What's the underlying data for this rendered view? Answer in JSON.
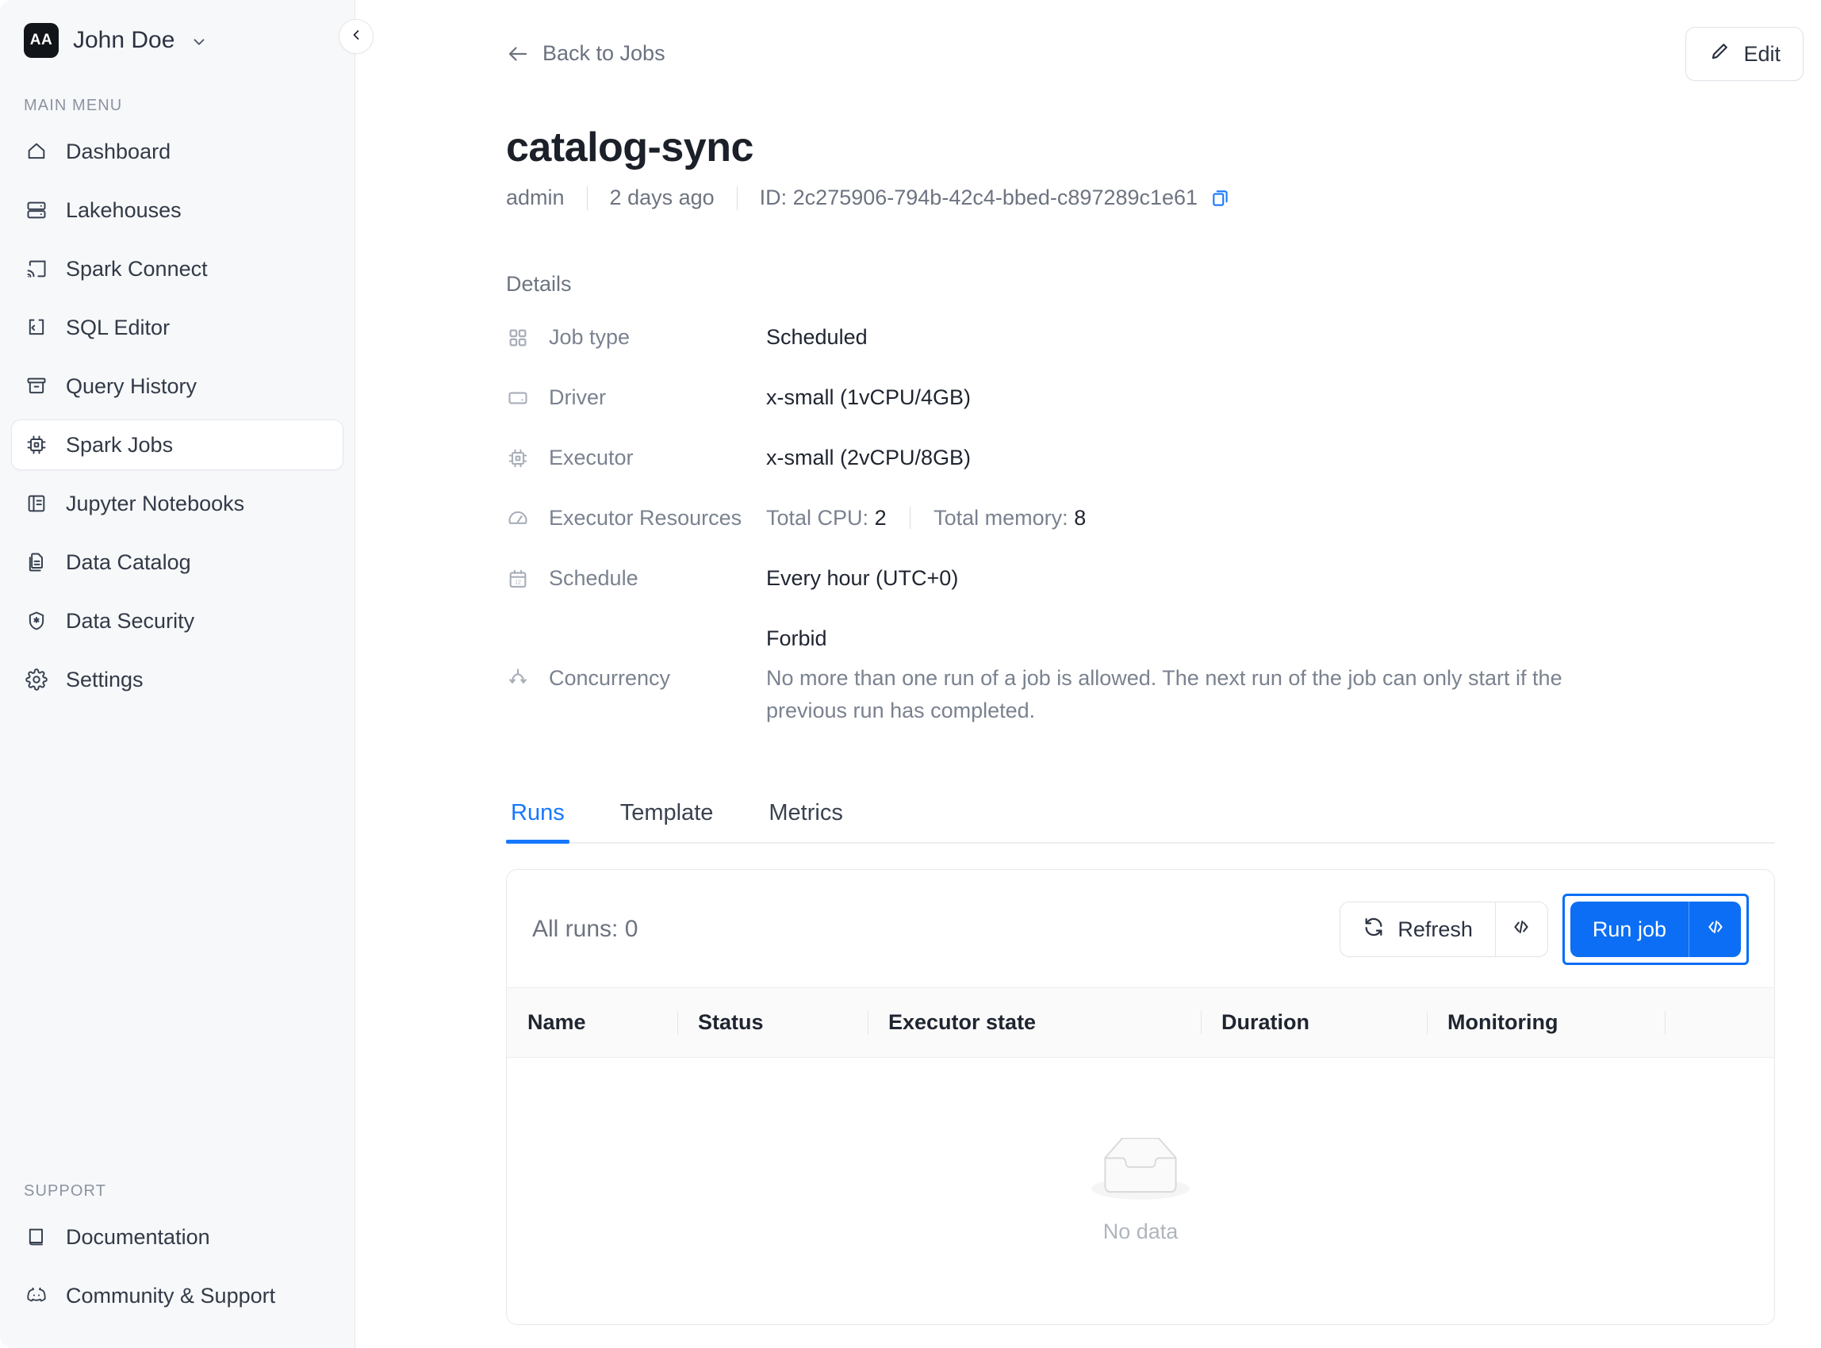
{
  "sidebar": {
    "user": {
      "initials": "AA",
      "name": "John Doe",
      "chevron_icon": "chevron-down-icon"
    },
    "collapse_icon": "chevron-left-icon",
    "main_menu_label": "MAIN MENU",
    "main_menu": [
      {
        "label": "Dashboard",
        "icon": "home-icon",
        "active": false
      },
      {
        "label": "Lakehouses",
        "icon": "server-icon",
        "active": false
      },
      {
        "label": "Spark Connect",
        "icon": "cast-icon",
        "active": false
      },
      {
        "label": "SQL Editor",
        "icon": "code-file-icon",
        "active": false
      },
      {
        "label": "Query History",
        "icon": "archive-icon",
        "active": false
      },
      {
        "label": "Spark Jobs",
        "icon": "cpu-icon",
        "active": true
      },
      {
        "label": "Jupyter Notebooks",
        "icon": "notebook-icon",
        "active": false
      },
      {
        "label": "Data Catalog",
        "icon": "documents-icon",
        "active": false
      },
      {
        "label": "Data Security",
        "icon": "shield-star-icon",
        "active": false
      },
      {
        "label": "Settings",
        "icon": "gear-icon",
        "active": false
      }
    ],
    "support_label": "SUPPORT",
    "support": [
      {
        "label": "Documentation",
        "icon": "book-icon"
      },
      {
        "label": "Community & Support",
        "icon": "discord-icon"
      }
    ]
  },
  "header": {
    "back_label": "Back to Jobs",
    "back_icon": "arrow-left-icon",
    "edit_label": "Edit",
    "edit_icon": "pencil-icon",
    "title": "catalog-sync",
    "owner": "admin",
    "updated": "2 days ago",
    "id_label": "ID: 2c275906-794b-42c4-bbed-c897289c1e61",
    "copy_icon": "copy-icon"
  },
  "details": {
    "heading": "Details",
    "rows": [
      {
        "icon": "grid-icon",
        "label": "Job type",
        "value": "Scheduled"
      },
      {
        "icon": "driver-icon",
        "label": "Driver",
        "value": "x-small (1vCPU/4GB)"
      },
      {
        "icon": "cpu-icon",
        "label": "Executor",
        "value": "x-small (2vCPU/8GB)"
      },
      {
        "icon": "gauge-icon",
        "label": "Executor Resources",
        "value": ""
      },
      {
        "icon": "calendar-icon",
        "label": "Schedule",
        "value": "Every hour (UTC+0)"
      },
      {
        "icon": "concurrency-icon",
        "label": "Concurrency",
        "value": ""
      }
    ],
    "resources": {
      "cpu_label": "Total CPU:",
      "cpu_value": "2",
      "memory_label": "Total memory:",
      "memory_value": "8"
    },
    "concurrency": {
      "mode": "Forbid",
      "description": "No more than one run of a job is allowed. The next run of the job can only start if the previous run has completed."
    }
  },
  "tabs": [
    {
      "label": "Runs",
      "active": true
    },
    {
      "label": "Template",
      "active": false
    },
    {
      "label": "Metrics",
      "active": false
    }
  ],
  "runs_card": {
    "count_label": "All runs: 0",
    "refresh_label": "Refresh",
    "refresh_icon": "refresh-icon",
    "refresh_code_icon": "code-brackets-icon",
    "run_label": "Run job",
    "run_code_icon": "code-brackets-icon",
    "columns": [
      "Name",
      "Status",
      "Executor state",
      "Duration",
      "Monitoring",
      ""
    ],
    "empty_text": "No data",
    "empty_icon": "empty-box-icon",
    "rows": []
  },
  "colors": {
    "accent": "#0b6ef5",
    "tab_active": "#1677ff",
    "sidebar_bg": "#f7f8fa",
    "text_primary": "#1f2530",
    "text_muted": "#7a828f"
  }
}
